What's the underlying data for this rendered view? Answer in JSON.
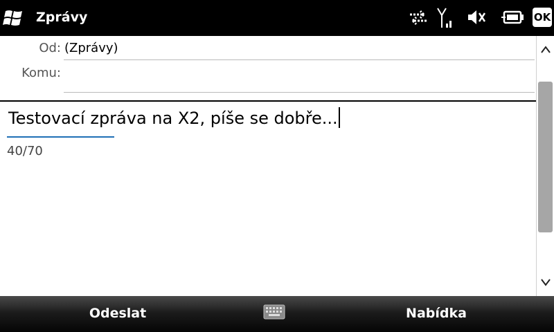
{
  "titlebar": {
    "title": "Zprávy",
    "ok_label": "OK",
    "icons": [
      "windows-start-icon",
      "connectivity-arrows-icon",
      "signal-strength-icon",
      "volume-muted-icon",
      "battery-icon"
    ]
  },
  "header": {
    "from_label": "Od:",
    "from_value": "(Zprávy)",
    "to_label": "Komu:",
    "to_value": ""
  },
  "message": {
    "text": "Testovací zpráva na X2, píše se dobře...",
    "counter": "40/70"
  },
  "softkeys": {
    "left": "Odeslat",
    "right": "Nabídka",
    "center_icon": "keyboard-icon"
  },
  "colors": {
    "titlebar_bg": "#000000",
    "underline_accent": "#1e6fb5",
    "scroll_thumb": "#a6a6a6"
  }
}
